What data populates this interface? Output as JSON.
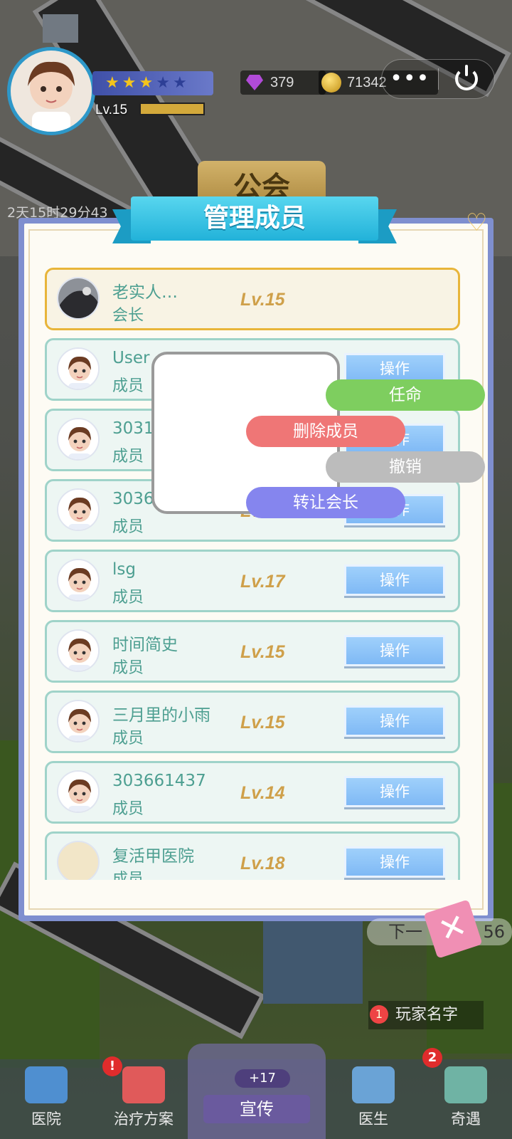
{
  "hud": {
    "level": "Lv.15",
    "stars_filled": 3,
    "stars_total": 5,
    "exp_fraction": 1.0,
    "gems": "379",
    "coins": "71342",
    "more_label": "•••",
    "timer": "2天15时29分43",
    "guild_tab": "公会"
  },
  "panel": {
    "title": "管理成员",
    "members": [
      {
        "name": "老实人…",
        "role": "会长",
        "level": "Lv.15",
        "leader": true
      },
      {
        "name": "User",
        "role": "成员",
        "level": "",
        "button": "操作"
      },
      {
        "name": "3031",
        "role": "成员",
        "level": "",
        "button": "操作"
      },
      {
        "name": "303647440",
        "role": "成员",
        "level": "Lv.11",
        "button": "操作"
      },
      {
        "name": "lsg",
        "role": "成员",
        "level": "Lv.17",
        "button": "操作"
      },
      {
        "name": "时间简史",
        "role": "成员",
        "level": "Lv.15",
        "button": "操作"
      },
      {
        "name": "三月里的小雨",
        "role": "成员",
        "level": "Lv.15",
        "button": "操作"
      },
      {
        "name": "303661437",
        "role": "成员",
        "level": "Lv.14",
        "button": "操作"
      },
      {
        "name": "复活甲医院",
        "role": "成员",
        "level": "Lv.18",
        "button": "操作"
      }
    ]
  },
  "menu": {
    "appoint": "任命",
    "delete": "删除成员",
    "revoke": "撤销",
    "transfer": "转让会长"
  },
  "side": {
    "close": "✕",
    "next_label": "下一",
    "next_value": "56",
    "player_name": "玩家名字",
    "medal": "1"
  },
  "tabs": {
    "hospital": "医院",
    "treatment": "治疗方案",
    "promote": "宣传",
    "promote_badge": "+17",
    "doctor": "医生",
    "miracle": "奇遇",
    "miracle_badge": "2",
    "treatment_badge": "!"
  },
  "colors": {
    "panel_border": "#7f8fcf",
    "ribbon": "#22b2d9",
    "row_border": "#9fd3c9",
    "leader_border": "#e8b53a",
    "level_text": "#cfa04a",
    "appoint": "#7ece5f",
    "delete": "#ef7676",
    "revoke": "#bcbcbc",
    "transfer": "#8585ee"
  }
}
